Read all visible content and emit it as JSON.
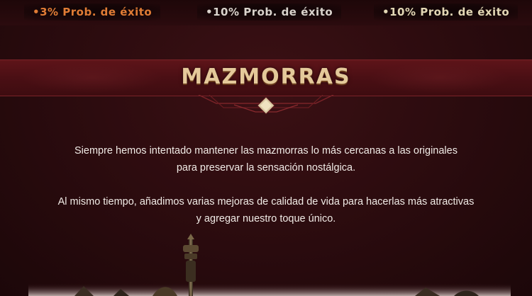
{
  "success_chances": [
    {
      "label": "•3% Prob. de éxito"
    },
    {
      "label": "•10% Prob. de éxito"
    },
    {
      "label": "•10% Prob. de éxito"
    }
  ],
  "section": {
    "title": "MAZMORRAS"
  },
  "description": {
    "paragraph1_line1": "Siempre hemos intentado mantener las mazmorras lo más cercanas a las originales",
    "paragraph1_line2": "para preservar la sensación nostálgica.",
    "paragraph2_line1": "Al mismo tiempo, añadimos varias mejoras de calidad de vida para hacerlas más atractivas",
    "paragraph2_line2": "y agregar nuestro toque único."
  },
  "colors": {
    "background": "#2a0b0e",
    "banner": "#4a0f14",
    "title_gold": "#e4c99a",
    "chance_orange": "#e07c35",
    "chance_silver": "#d9d3cc",
    "chance_gold": "#e2d7b5",
    "text": "#f1ebe6"
  },
  "icons": {
    "ornament": "diamond-ornament-icon",
    "art": "dungeon-artwork"
  }
}
